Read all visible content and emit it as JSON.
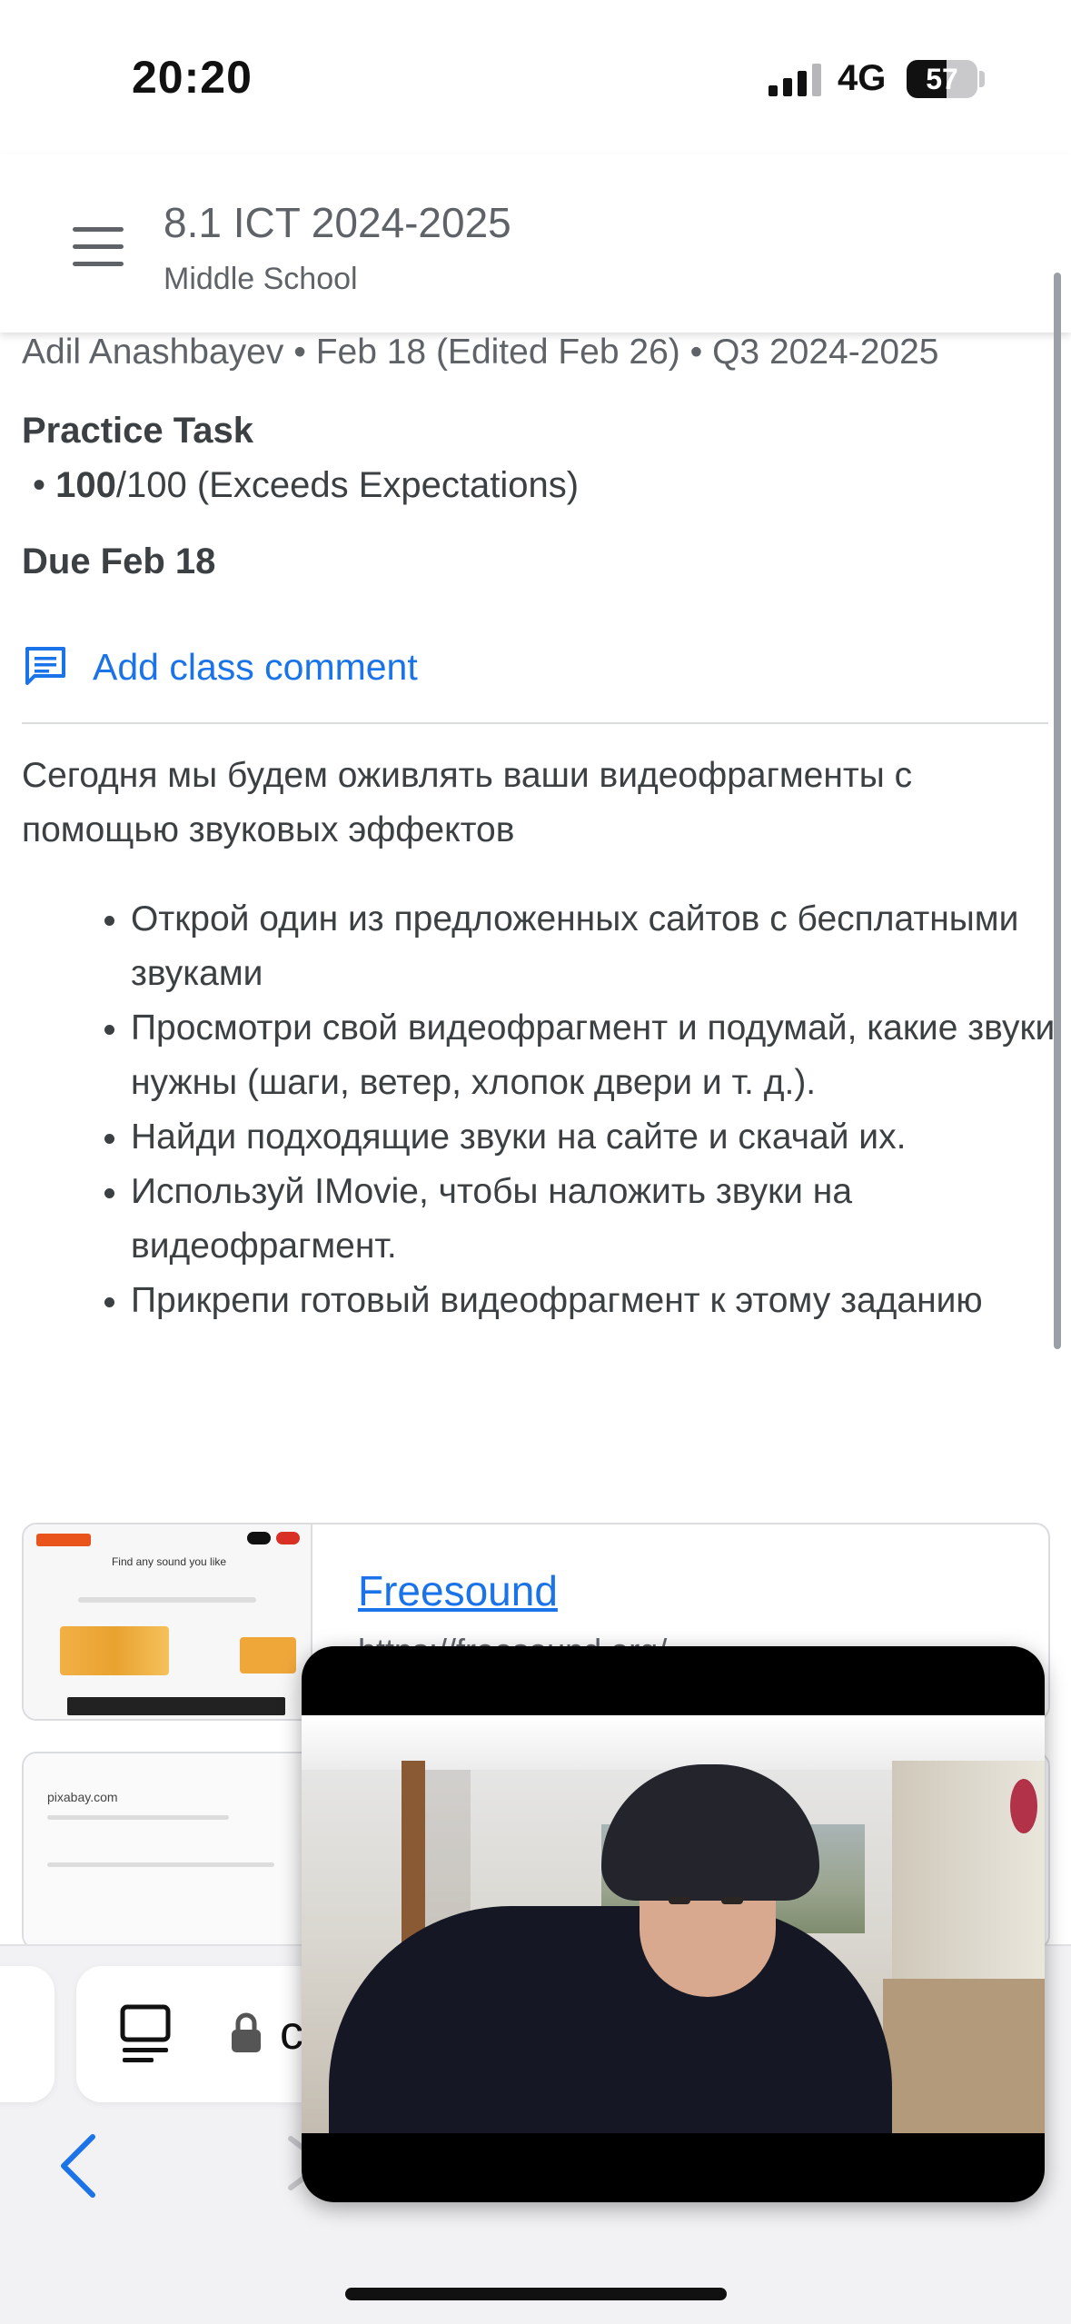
{
  "status_bar": {
    "time": "20:20",
    "network": "4G",
    "battery": "57",
    "battery_level": 0.57
  },
  "header": {
    "title": "8.1 ICT 2024-2025",
    "subtitle": "Middle School"
  },
  "assignment": {
    "meta": "Adil Anashbayev • Feb 18 (Edited Feb 26) • Q3 2024-2025",
    "title": "Practice Task",
    "grade_bullet": "•",
    "grade_score": "100",
    "grade_rest": "/100 (Exceeds Expectations)",
    "due": "Due Feb 18",
    "add_comment": "Add class comment",
    "description": "Сегодня мы будем оживлять ваши видеофрагменты с помощью звуковых эффектов",
    "steps": [
      "Открой один из предложенных сайтов с бесплатными звуками",
      "Просмотри свой видеофрагмент и подумай, какие звуки нужны (шаги, ветер, хлопок двери и т. д.).",
      "Найди подходящие звуки на сайте и скачай их.",
      "Используй IMovie, чтобы наложить звуки на видеофрагмент.",
      "Прикрепи готовый видеофрагмент к этому заданию"
    ]
  },
  "attachments": [
    {
      "title": "Freesound",
      "url": "https://freesound.org/",
      "thumb_heading": "Find any sound you like"
    },
    {
      "thumb_heading": "pixabay.com"
    }
  ],
  "browser": {
    "address_partial": "c"
  },
  "colors": {
    "accent": "#1a73e8",
    "text": "#3c4043",
    "muted": "#5f6368"
  },
  "icons": {
    "menu": "menu-icon",
    "comment": "comment-icon",
    "reader": "reader-mode-icon",
    "lock": "lock-icon",
    "back": "back-icon",
    "forward": "forward-icon"
  }
}
